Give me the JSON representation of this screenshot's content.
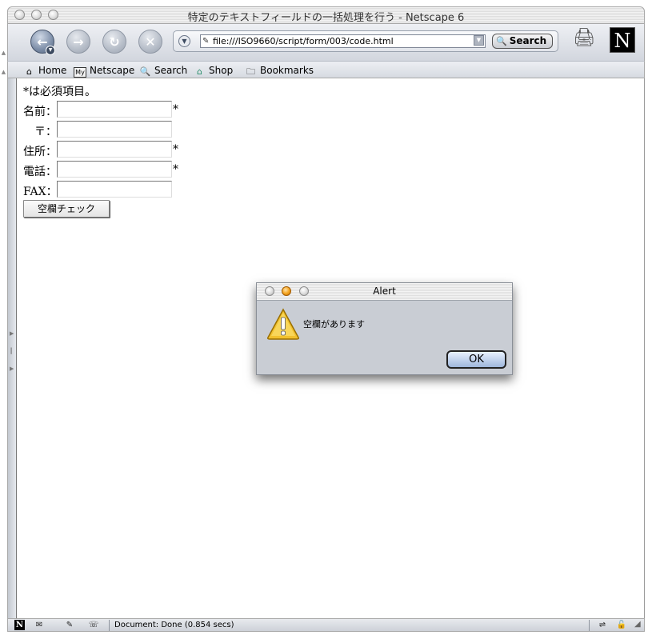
{
  "window": {
    "title": "特定のテキストフィールドの一括処理を行う - Netscape 6"
  },
  "navigation": {
    "back_glyph": "←",
    "forward_glyph": "→",
    "reload_glyph": "↻",
    "stop_glyph": "✕",
    "url": "file:///ISO9660/script/form/003/code.html",
    "search_label": "Search"
  },
  "personal_toolbar": {
    "items": [
      {
        "label": "Home",
        "icon": "house-icon",
        "glyph": "⌂"
      },
      {
        "label": "Netscape",
        "icon": "my-netscape-icon",
        "glyph": "My"
      },
      {
        "label": "Search",
        "icon": "magnifier-icon",
        "glyph": "🔍"
      },
      {
        "label": "Shop",
        "icon": "shop-icon",
        "glyph": "⌂"
      },
      {
        "label": "Bookmarks",
        "icon": "folder-icon",
        "glyph": "🗀"
      }
    ]
  },
  "logo": {
    "letter": "N"
  },
  "form": {
    "note": "*は必須項目。",
    "fields": [
      {
        "label": "名前：",
        "value": "",
        "required": "*"
      },
      {
        "label": "〒：",
        "value": "",
        "required": ""
      },
      {
        "label": "住所：",
        "value": "",
        "required": "*"
      },
      {
        "label": "電話：",
        "value": "",
        "required": "*"
      },
      {
        "label": "FAX：",
        "value": "",
        "required": ""
      }
    ],
    "button_label": "空欄チェック"
  },
  "status_bar": {
    "text": "Document: Done (0.854 secs)",
    "n_glyph": "N"
  },
  "alert": {
    "title": "Alert",
    "message": "空欄があります",
    "ok_label": "OK"
  },
  "colors": {
    "warning_yellow": "#f2c12e",
    "ok_button_blue": "#9fb7dc",
    "alert_bg": "#c9cdd4"
  }
}
